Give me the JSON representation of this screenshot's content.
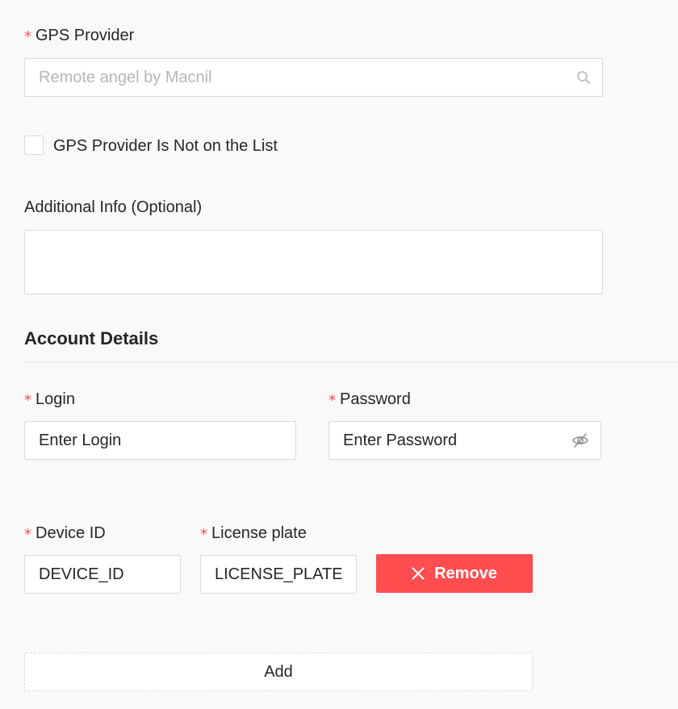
{
  "gps_provider": {
    "required_mark": "*",
    "label": "GPS Provider",
    "placeholder": "Remote angel by Macnil"
  },
  "not_on_list": {
    "label": "GPS Provider Is Not on the List"
  },
  "additional_info": {
    "label": "Additional Info (Optional)"
  },
  "account_details": {
    "title": "Account Details",
    "login": {
      "required_mark": "*",
      "label": "Login",
      "value": "Enter Login"
    },
    "password": {
      "required_mark": "*",
      "label": "Password",
      "value": "Enter Password"
    }
  },
  "device": {
    "device_id": {
      "required_mark": "*",
      "label": "Device ID",
      "value": "DEVICE_ID"
    },
    "license_plate": {
      "required_mark": "*",
      "label": "License plate",
      "value": "LICENSE_PLATE"
    },
    "remove_label": "Remove"
  },
  "add_label": "Add",
  "colors": {
    "required": "#ff4d4f",
    "remove_button": "#ff4d50",
    "border": "#d9d9d9",
    "background": "#f9f9f9"
  },
  "icons": {
    "search": "search-icon",
    "password_toggle": "eye-slash-icon",
    "remove": "close-icon"
  }
}
